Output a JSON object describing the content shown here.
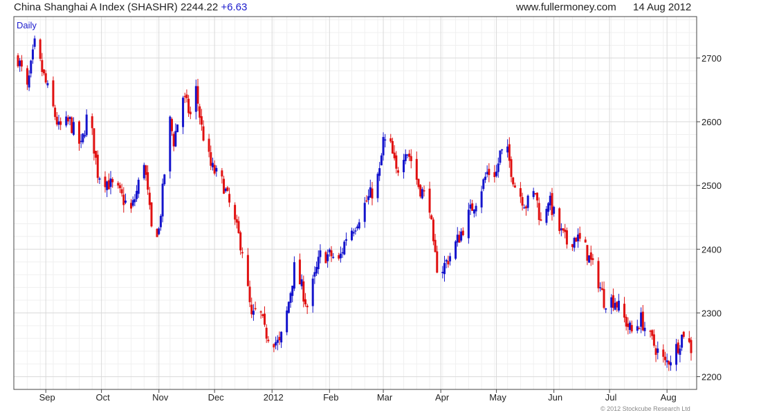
{
  "header": {
    "title": "China Shanghai A Index (SHASHR) 2244.22",
    "change": "+6.63",
    "site": "www.fullermoney.com",
    "date": "14 Aug 2012"
  },
  "period_label": "Daily",
  "copyright": "© 2012 Stockcube Research Ltd",
  "colors": {
    "up": "#1414cc",
    "down": "#e01010",
    "grid": "#d9d9d9",
    "frame": "#444444"
  },
  "chart_data": {
    "type": "candlestick",
    "title": "China Shanghai A Index (SHASHR) 2244.22 +6.63",
    "period": "Daily",
    "ylim": [
      2180,
      2765
    ],
    "y_ticks": [
      2200,
      2300,
      2400,
      2500,
      2600,
      2700
    ],
    "x_labels": [
      {
        "label": "Sep",
        "date": "2011-09-01"
      },
      {
        "label": "Oct",
        "date": "2011-10-01"
      },
      {
        "label": "Nov",
        "date": "2011-11-01"
      },
      {
        "label": "Dec",
        "date": "2011-12-01"
      },
      {
        "label": "2012",
        "date": "2012-01-01"
      },
      {
        "label": "Feb",
        "date": "2012-02-01"
      },
      {
        "label": "Mar",
        "date": "2012-03-01"
      },
      {
        "label": "Apr",
        "date": "2012-04-01"
      },
      {
        "label": "May",
        "date": "2012-05-01"
      },
      {
        "label": "Jun",
        "date": "2012-06-01"
      },
      {
        "label": "Jul",
        "date": "2012-07-01"
      },
      {
        "label": "Aug",
        "date": "2012-08-01"
      }
    ],
    "date_range": [
      "2011-08-17",
      "2012-08-14"
    ],
    "close_path": [
      [
        "2011-08-17",
        2700
      ],
      [
        "2011-08-22",
        2650
      ],
      [
        "2011-08-26",
        2720
      ],
      [
        "2011-08-30",
        2680
      ],
      [
        "2011-09-05",
        2620
      ],
      [
        "2011-09-08",
        2590
      ],
      [
        "2011-09-14",
        2600
      ],
      [
        "2011-09-20",
        2560
      ],
      [
        "2011-09-24",
        2620
      ],
      [
        "2011-09-29",
        2520
      ],
      [
        "2011-10-10",
        2490
      ],
      [
        "2011-10-17",
        2460
      ],
      [
        "2011-10-20",
        2490
      ],
      [
        "2011-10-24",
        2540
      ],
      [
        "2011-10-28",
        2430
      ],
      [
        "2011-11-01",
        2430
      ],
      [
        "2011-11-04",
        2520
      ],
      [
        "2011-11-07",
        2600
      ],
      [
        "2011-11-09",
        2570
      ],
      [
        "2011-11-14",
        2640
      ],
      [
        "2011-11-18",
        2610
      ],
      [
        "2011-11-21",
        2650
      ],
      [
        "2011-11-24",
        2590
      ],
      [
        "2011-11-29",
        2530
      ],
      [
        "2011-12-06",
        2500
      ],
      [
        "2011-12-12",
        2440
      ],
      [
        "2011-12-16",
        2400
      ],
      [
        "2011-12-21",
        2290
      ],
      [
        "2011-12-25",
        2310
      ],
      [
        "2011-12-28",
        2270
      ],
      [
        "2012-01-05",
        2250
      ],
      [
        "2012-01-09",
        2300
      ],
      [
        "2012-01-13",
        2370
      ],
      [
        "2012-01-17",
        2340
      ],
      [
        "2012-01-20",
        2310
      ],
      [
        "2012-01-27",
        2390
      ],
      [
        "2012-02-02",
        2390
      ],
      [
        "2012-02-06",
        2380
      ],
      [
        "2012-02-10",
        2420
      ],
      [
        "2012-02-15",
        2440
      ],
      [
        "2012-02-20",
        2470
      ],
      [
        "2012-02-24",
        2490
      ],
      [
        "2012-02-28",
        2520
      ],
      [
        "2012-03-01",
        2570
      ],
      [
        "2012-03-05",
        2560
      ],
      [
        "2012-03-08",
        2520
      ],
      [
        "2012-03-13",
        2560
      ],
      [
        "2012-03-16",
        2540
      ],
      [
        "2012-03-20",
        2500
      ],
      [
        "2012-03-26",
        2470
      ],
      [
        "2012-03-28",
        2400
      ],
      [
        "2012-03-31",
        2360
      ],
      [
        "2012-04-06",
        2390
      ],
      [
        "2012-04-11",
        2420
      ],
      [
        "2012-04-17",
        2460
      ],
      [
        "2012-04-22",
        2490
      ],
      [
        "2012-04-26",
        2520
      ],
      [
        "2012-05-01",
        2520
      ],
      [
        "2012-05-03",
        2550
      ],
      [
        "2012-05-07",
        2550
      ],
      [
        "2012-05-11",
        2500
      ],
      [
        "2012-05-17",
        2470
      ],
      [
        "2012-05-22",
        2490
      ],
      [
        "2012-05-25",
        2440
      ],
      [
        "2012-05-29",
        2480
      ],
      [
        "2012-06-04",
        2430
      ],
      [
        "2012-06-08",
        2410
      ],
      [
        "2012-06-13",
        2420
      ],
      [
        "2012-06-18",
        2400
      ],
      [
        "2012-06-25",
        2350
      ],
      [
        "2012-06-28",
        2320
      ],
      [
        "2012-07-04",
        2320
      ],
      [
        "2012-07-09",
        2290
      ],
      [
        "2012-07-13",
        2270
      ],
      [
        "2012-07-18",
        2290
      ],
      [
        "2012-07-23",
        2260
      ],
      [
        "2012-07-27",
        2240
      ],
      [
        "2012-07-31",
        2220
      ],
      [
        "2012-08-03",
        2230
      ],
      [
        "2012-08-07",
        2250
      ],
      [
        "2012-08-10",
        2270
      ],
      [
        "2012-08-14",
        2244
      ]
    ]
  }
}
